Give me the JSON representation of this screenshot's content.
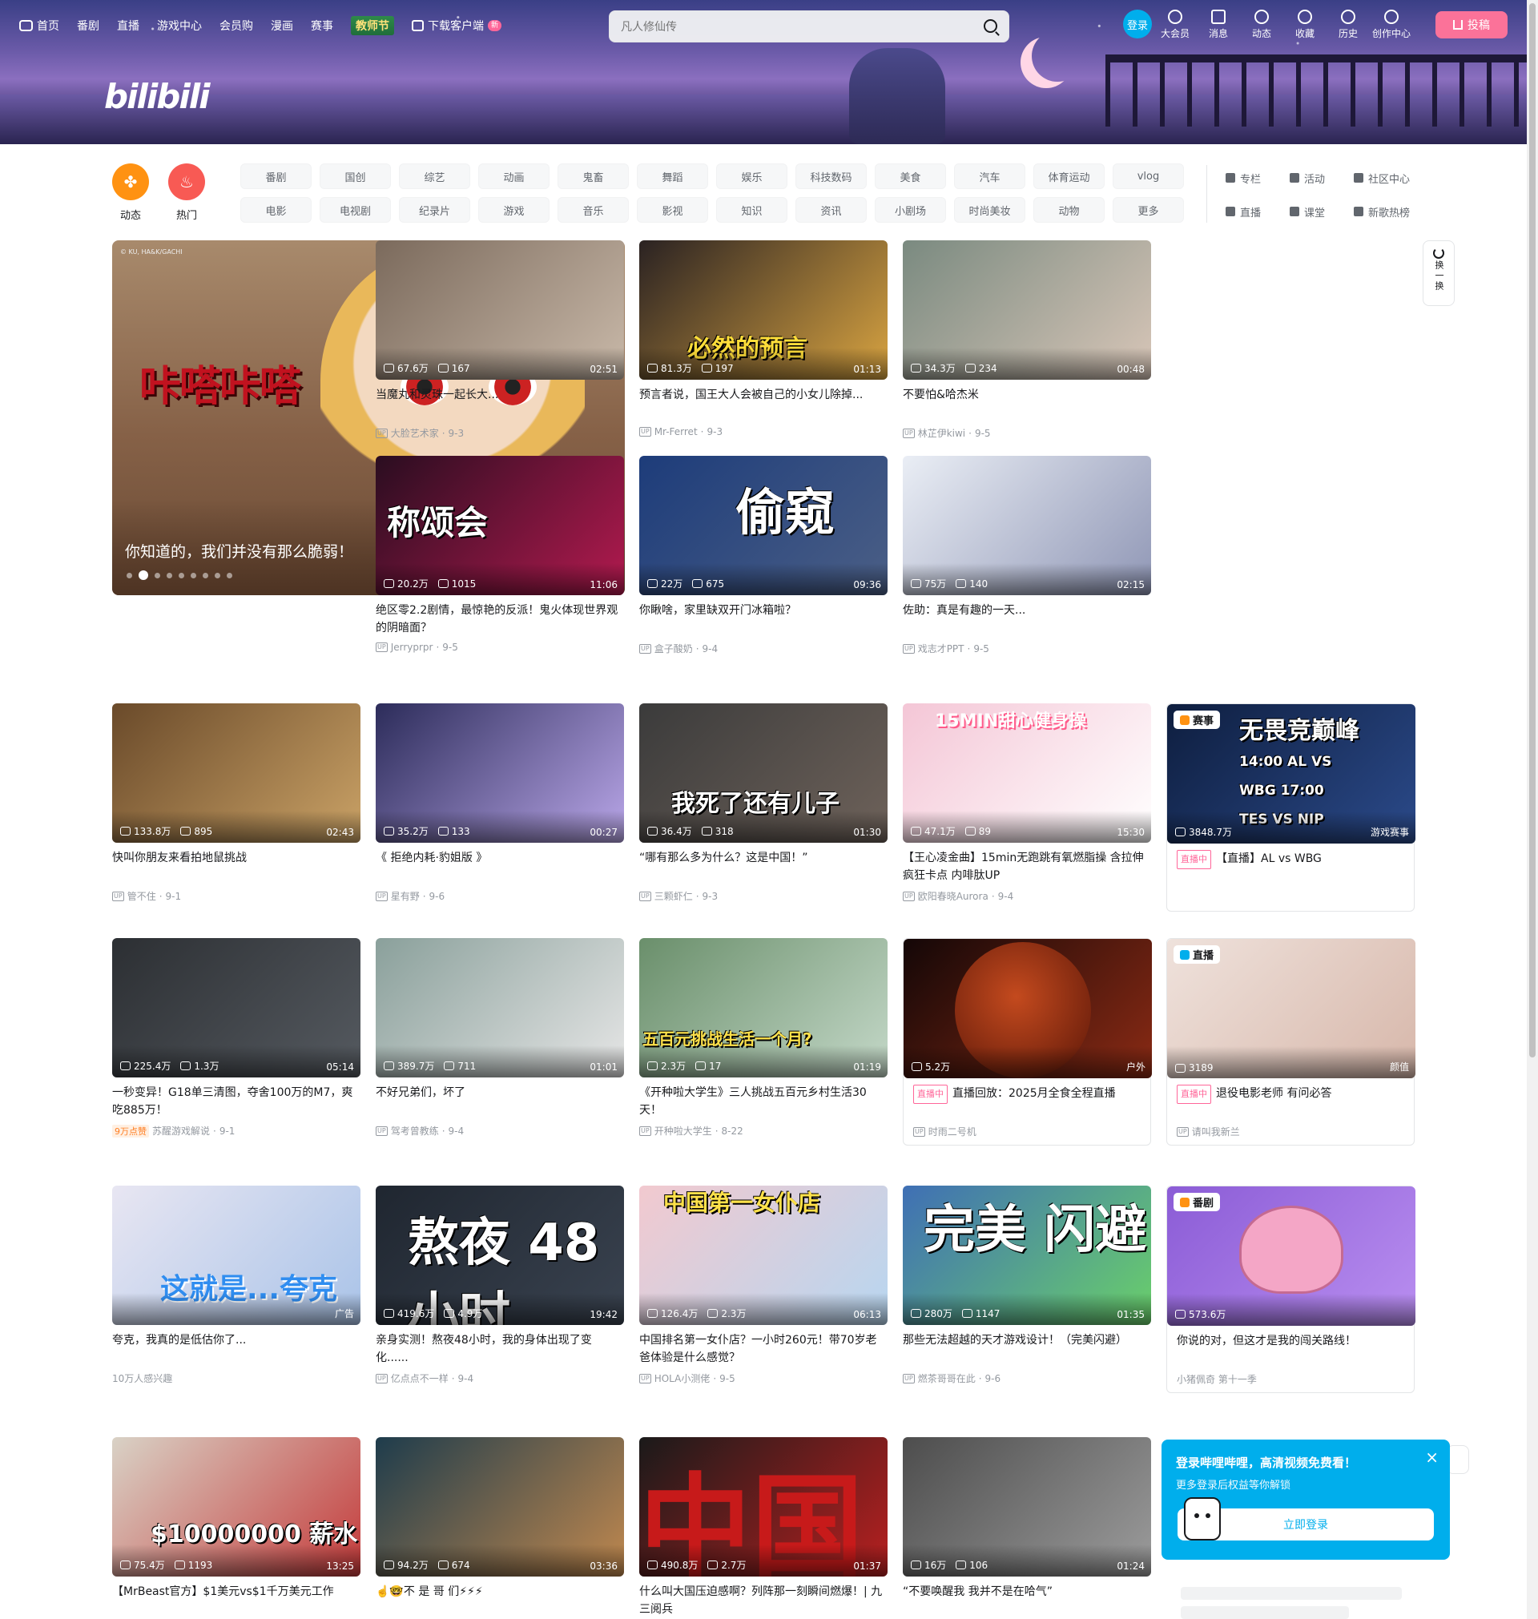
{
  "nav": {
    "left_items": [
      "首页",
      "番剧",
      "直播",
      "游戏中心",
      "会员购",
      "漫画",
      "赛事"
    ],
    "special": "教师节",
    "download": "下载客户端",
    "download_badge": "新"
  },
  "search": {
    "placeholder": "凡人修仙传"
  },
  "user": {
    "login": "登录",
    "items": [
      "大会员",
      "消息",
      "动态",
      "收藏",
      "历史",
      "创作中心"
    ],
    "upload": "投稿"
  },
  "banner": {
    "logo": "bilibili"
  },
  "channels": {
    "dynamic": "动态",
    "hot": "热门",
    "tags": [
      "番剧",
      "国创",
      "综艺",
      "动画",
      "鬼畜",
      "舞蹈",
      "娱乐",
      "科技数码",
      "美食",
      "汽车",
      "体育运动",
      "vlog",
      "电影",
      "电视剧",
      "纪录片",
      "游戏",
      "音乐",
      "影视",
      "知识",
      "资讯",
      "小剧场",
      "时尚美妆",
      "动物",
      "更多"
    ],
    "side_links": [
      "专栏",
      "活动",
      "社区中心",
      "直播",
      "课堂",
      "新歌热榜"
    ]
  },
  "carousel": {
    "copyright": "© KU, HA&K/GACHI",
    "stamp": "咔嗒咔嗒",
    "title": "你知道的，我们并没有那么脆弱！",
    "prev": "‹",
    "next": "›"
  },
  "refresh": {
    "label": "换一换"
  },
  "cards": [
    {
      "title": "当魔丸和灵珠一起长大...",
      "views": "67.6万",
      "danmaku": "167",
      "duration": "02:51",
      "author": "大脸艺术家",
      "date": "9-3",
      "word": ""
    },
    {
      "title": "预言者说，国王大人会被自己的小女儿除掉...",
      "views": "81.3万",
      "danmaku": "197",
      "duration": "01:13",
      "author": "Mr-Ferret",
      "date": "9-3",
      "word": "必然的预言"
    },
    {
      "title": "不要怕&哈杰米",
      "views": "34.3万",
      "danmaku": "234",
      "duration": "00:48",
      "author": "林芷伊kiwi",
      "date": "9-5",
      "word": ""
    },
    {
      "title": "绝区零2.2剧情，最惊艳的反派！鬼火体现世界观的阴暗面？",
      "views": "20.2万",
      "danmaku": "1015",
      "duration": "11:06",
      "author": "Jerryprpr",
      "date": "9-5",
      "word": "称颂会"
    },
    {
      "title": "你瞅啥，家里缺双开门冰箱啦？",
      "views": "22万",
      "danmaku": "675",
      "duration": "09:36",
      "author": "盒子酸奶",
      "date": "9-4",
      "word": "偷窥"
    },
    {
      "title": "佐助：真是有趣的一天...",
      "views": "75万",
      "danmaku": "140",
      "duration": "02:15",
      "author": "戏志才PPT",
      "date": "9-5",
      "word": ""
    },
    {
      "title": "快叫你朋友来看拍地鼠挑战",
      "views": "133.8万",
      "danmaku": "895",
      "duration": "02:43",
      "author": "管不住",
      "date": "9-1",
      "word": ""
    },
    {
      "title": "《 拒绝内耗·豹姐版 》",
      "views": "35.2万",
      "danmaku": "133",
      "duration": "00:27",
      "author": "星有野",
      "date": "9-6",
      "word": ""
    },
    {
      "title": "“哪有那么多为什么？这是中国！”",
      "views": "36.4万",
      "danmaku": "318",
      "duration": "01:30",
      "author": "三颗虾仁",
      "date": "9-3",
      "word": "我死了还有儿子"
    },
    {
      "title": "【王心凌金曲】15min无跑跳有氧燃脂操 含拉伸 疯狂卡点 内啡肽UP",
      "views": "47.1万",
      "danmaku": "89",
      "duration": "15:30",
      "author": "欧阳春晓Aurora",
      "date": "9-4",
      "word": "15MIN甜心健身操"
    },
    {
      "title": "一秒变异！G18单三清图，夺舍100万的M7，爽吃885万！",
      "views": "225.4万",
      "danmaku": "1.3万",
      "duration": "05:14",
      "author": "苏醒游戏解说",
      "date": "9-1",
      "word": "",
      "hot": "9万点赞"
    },
    {
      "title": "不好兄弟们，坏了",
      "views": "389.7万",
      "danmaku": "711",
      "duration": "01:01",
      "author": "驾考曾教练",
      "date": "9-4",
      "word": ""
    },
    {
      "title": "《开种啦大学生》三人挑战五百元乡村生活30天！",
      "views": "2.3万",
      "danmaku": "17",
      "duration": "01:19",
      "author": "开种啦大学生",
      "date": "8-22",
      "word": "五百元挑战生活一个月?"
    },
    {
      "title": "夸克，我真的是低估你了...",
      "views": "",
      "danmaku": "",
      "duration": "广告",
      "author": "10万人感兴趣",
      "date": "",
      "word": "这就是...夸克"
    },
    {
      "title": "亲身实测！熬夜48小时，我的身体出现了变化......",
      "views": "419.6万",
      "danmaku": "4.9万",
      "duration": "19:42",
      "author": "亿点点不一样",
      "date": "9-4",
      "word": "熬夜 48小时"
    },
    {
      "title": "中国排名第一女仆店？一小时260元！带70岁老爸体验是什么感觉？",
      "views": "126.4万",
      "danmaku": "2.3万",
      "duration": "06:13",
      "author": "HOLA小测佬",
      "date": "9-5",
      "word": "中国第一女仆店"
    },
    {
      "title": "那些无法超越的天才游戏设计！（完美闪避）",
      "views": "280万",
      "danmaku": "1147",
      "duration": "01:35",
      "author": "燃茶哥哥在此",
      "date": "9-6",
      "word": "完美 闪避"
    },
    {
      "title": "【MrBeast官方】$1美元vs$1千万美元工作",
      "views": "75.4万",
      "danmaku": "1193",
      "duration": "13:25",
      "author": "",
      "date": "",
      "word": "$10000000 薪水"
    },
    {
      "title": "☝️🤓不 是 哥 们⚡⚡⚡",
      "views": "94.2万",
      "danmaku": "674",
      "duration": "03:36",
      "author": "",
      "date": "",
      "word": ""
    },
    {
      "title": "什么叫大国压迫感啊？列阵那一刻瞬间燃爆！| 九三阅兵",
      "views": "490.8万",
      "danmaku": "2.7万",
      "duration": "01:37",
      "author": "",
      "date": "",
      "word": "中国"
    },
    {
      "title": "“不要唤醒我 我并不是在哈气”",
      "views": "16万",
      "danmaku": "106",
      "duration": "01:24",
      "author": "",
      "date": "",
      "word": ""
    }
  ],
  "boxed": [
    {
      "badge": "赛事",
      "thumb_title": "无畏竞巅峰",
      "thumb_sub": "14:00 AL VS WBG 17:00 TES VS NIP",
      "views": "3848.7万",
      "tag": "游戏赛事",
      "live": "直播中",
      "title": "【直播】AL vs WBG",
      "author": ""
    },
    {
      "badge": "直播",
      "views": "3189",
      "tag": "颜值",
      "live": "直播中",
      "title": "退役电影老师 有问必答",
      "author": "请叫我新兰"
    },
    {
      "badge": "",
      "views": "5.2万",
      "tag": "户外",
      "live": "直播中",
      "title": "直播回放：2025月全食全程直播",
      "author": "时雨二号机"
    },
    {
      "badge": "番剧",
      "views": "573.6万",
      "tag": "",
      "live": "",
      "title": "你说的对，但这才是我的闯关路线！",
      "author": "小猪佩奇 第十一季"
    }
  ],
  "popup": {
    "title": "登录哔哩哔哩，高清视频免费看！",
    "sub": "更多登录后权益等你解锁",
    "button": "立即登录",
    "close": "×"
  },
  "colors": {
    "brand_pink": "#fb7299",
    "brand_blue": "#00aeec",
    "orange": "#ff9212",
    "red": "#ff6b6b"
  }
}
